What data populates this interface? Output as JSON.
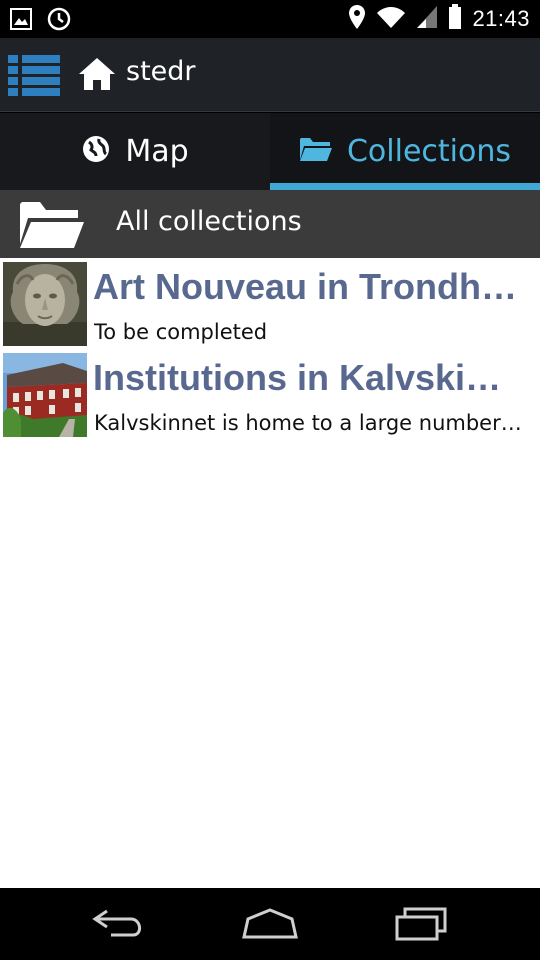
{
  "status_bar": {
    "time": "21:43",
    "icons": [
      "gallery-icon",
      "sync-icon",
      "location-icon",
      "wifi-icon",
      "signal-icon",
      "battery-icon"
    ]
  },
  "action_bar": {
    "menu_icon": "list-menu-icon",
    "home_icon": "home-icon",
    "title": "stedr"
  },
  "tabs": [
    {
      "label": "Map",
      "icon": "globe-icon",
      "selected": false
    },
    {
      "label": "Collections",
      "icon": "folder-icon",
      "selected": true
    }
  ],
  "sub_header": {
    "icon": "folder-open-icon",
    "label": "All collections"
  },
  "collections": [
    {
      "title": "Art Nouveau in Trondheim",
      "description": "To be completed",
      "thumbnail": "stone-face-sculpture"
    },
    {
      "title": "Institutions in Kalvskinnet",
      "description": "Kalvskinnet is home to a large number of institutions",
      "thumbnail": "red-wooden-house"
    }
  ],
  "nav_bar": {
    "buttons": [
      "back-icon",
      "home-nav-icon",
      "recent-apps-icon"
    ]
  },
  "colors": {
    "accent": "#3fa8d4",
    "title_text": "#58688f",
    "action_bar": "#1f2227",
    "sub_header": "#3b3b3b"
  }
}
